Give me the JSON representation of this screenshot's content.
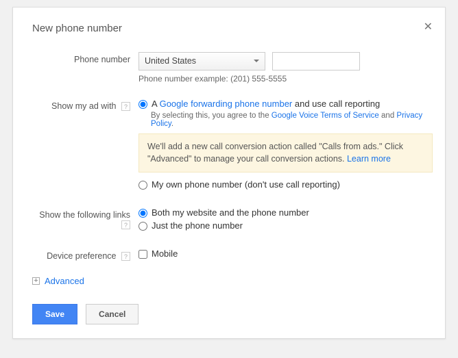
{
  "title": "New phone number",
  "labels": {
    "phone_number": "Phone number",
    "show_ad_with": "Show my ad with",
    "show_links": "Show the following links",
    "device_pref": "Device preference"
  },
  "phone": {
    "country": "United States",
    "example_hint": "Phone number example: (201) 555-5555",
    "value": ""
  },
  "show_ad": {
    "opt_forwarding_prefix": "A ",
    "opt_forwarding_link": "Google forwarding phone number",
    "opt_forwarding_suffix": " and use call reporting",
    "agree_prefix": "By selecting this, you agree to the ",
    "tos_link": "Google Voice Terms of Service",
    "agree_and": " and ",
    "privacy_link": "Privacy Policy",
    "agree_period": ".",
    "info_text": "We'll add a new call conversion action called \"Calls from ads.\" Click \"Advanced\" to manage your call conversion actions. ",
    "info_learn_more": "Learn more",
    "opt_own": "My own phone number (don't use call reporting)"
  },
  "links": {
    "both": "Both my website and the phone number",
    "just_phone": "Just the phone number"
  },
  "device": {
    "mobile": "Mobile"
  },
  "advanced_label": "Advanced",
  "actions": {
    "save": "Save",
    "cancel": "Cancel"
  }
}
